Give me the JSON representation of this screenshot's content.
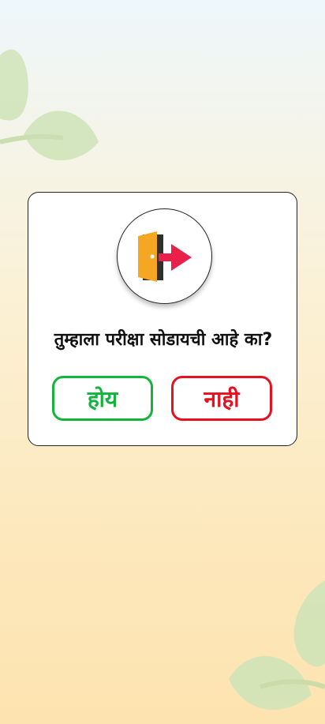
{
  "dialog": {
    "icon": "exit-door-icon",
    "question": "तुम्हाला परीक्षा सोडायची आहे का?",
    "yes_label": "होय",
    "no_label": "नाही"
  },
  "colors": {
    "yes": "#12b53c",
    "no": "#e6101f",
    "door": "#f5a623",
    "arrow": "#e8204a"
  }
}
